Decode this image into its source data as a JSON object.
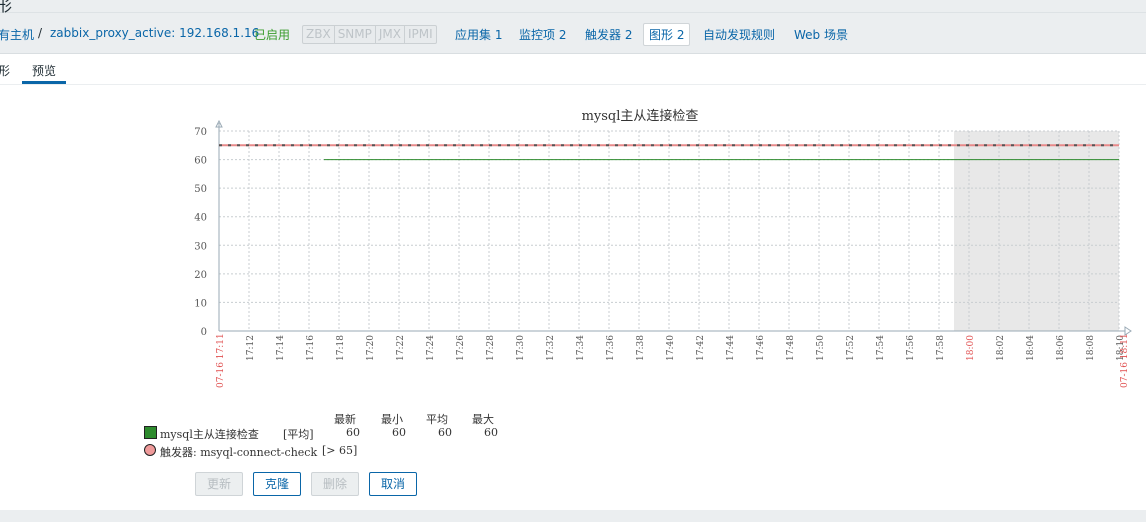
{
  "header": {
    "title_fragment": "形"
  },
  "nav": {
    "breadcrumb_all_hosts": "有主机",
    "separator": "/",
    "host": "zabbix_proxy_active: 192.168.1.16",
    "status": "已启用",
    "availability": [
      "ZBX",
      "SNMP",
      "JMX",
      "IPMI"
    ],
    "links": [
      "应用集 1",
      "监控项 2",
      "触发器 2",
      "图形 2",
      "自动发现规则",
      "Web 场景"
    ]
  },
  "tabs": [
    "形",
    "预览"
  ],
  "chart_data": {
    "type": "line",
    "title": "mysql主从连接检查",
    "ylim": [
      0,
      70
    ],
    "yticks": [
      0,
      10,
      20,
      30,
      40,
      50,
      60,
      70
    ],
    "x_start_label": "07-16 17:11",
    "x_end_label": "07-16 18:11",
    "xticks": [
      "17:12",
      "17:14",
      "17:16",
      "17:18",
      "17:20",
      "17:22",
      "17:24",
      "17:26",
      "17:28",
      "17:30",
      "17:32",
      "17:34",
      "17:36",
      "17:38",
      "17:40",
      "17:42",
      "17:44",
      "17:46",
      "17:48",
      "17:50",
      "17:52",
      "17:54",
      "17:56",
      "17:58",
      "18:00",
      "18:02",
      "18:04",
      "18:06",
      "18:08",
      "18:10"
    ],
    "x_range_minutes": [
      0,
      60
    ],
    "series": [
      {
        "name": "mysql主从连接检查",
        "color": "#2e8b2e",
        "start_minute": 7,
        "end_minute": 60,
        "value": 60
      }
    ],
    "trigger": {
      "value": 65,
      "color": "#e88a8a"
    },
    "shaded_from_minute": 49,
    "grid": true
  },
  "legend": {
    "headers": [
      "最新",
      "最小",
      "平均",
      "最大"
    ],
    "item": {
      "name": "mysql主从连接检查",
      "func": "[平均]",
      "values": [
        "60",
        "60",
        "60",
        "60"
      ]
    },
    "trigger": {
      "name": "触发器: msyql-connect-check",
      "cond": "[> 65]"
    }
  },
  "buttons": {
    "update": "更新",
    "clone": "克隆",
    "delete": "删除",
    "cancel": "取消"
  }
}
